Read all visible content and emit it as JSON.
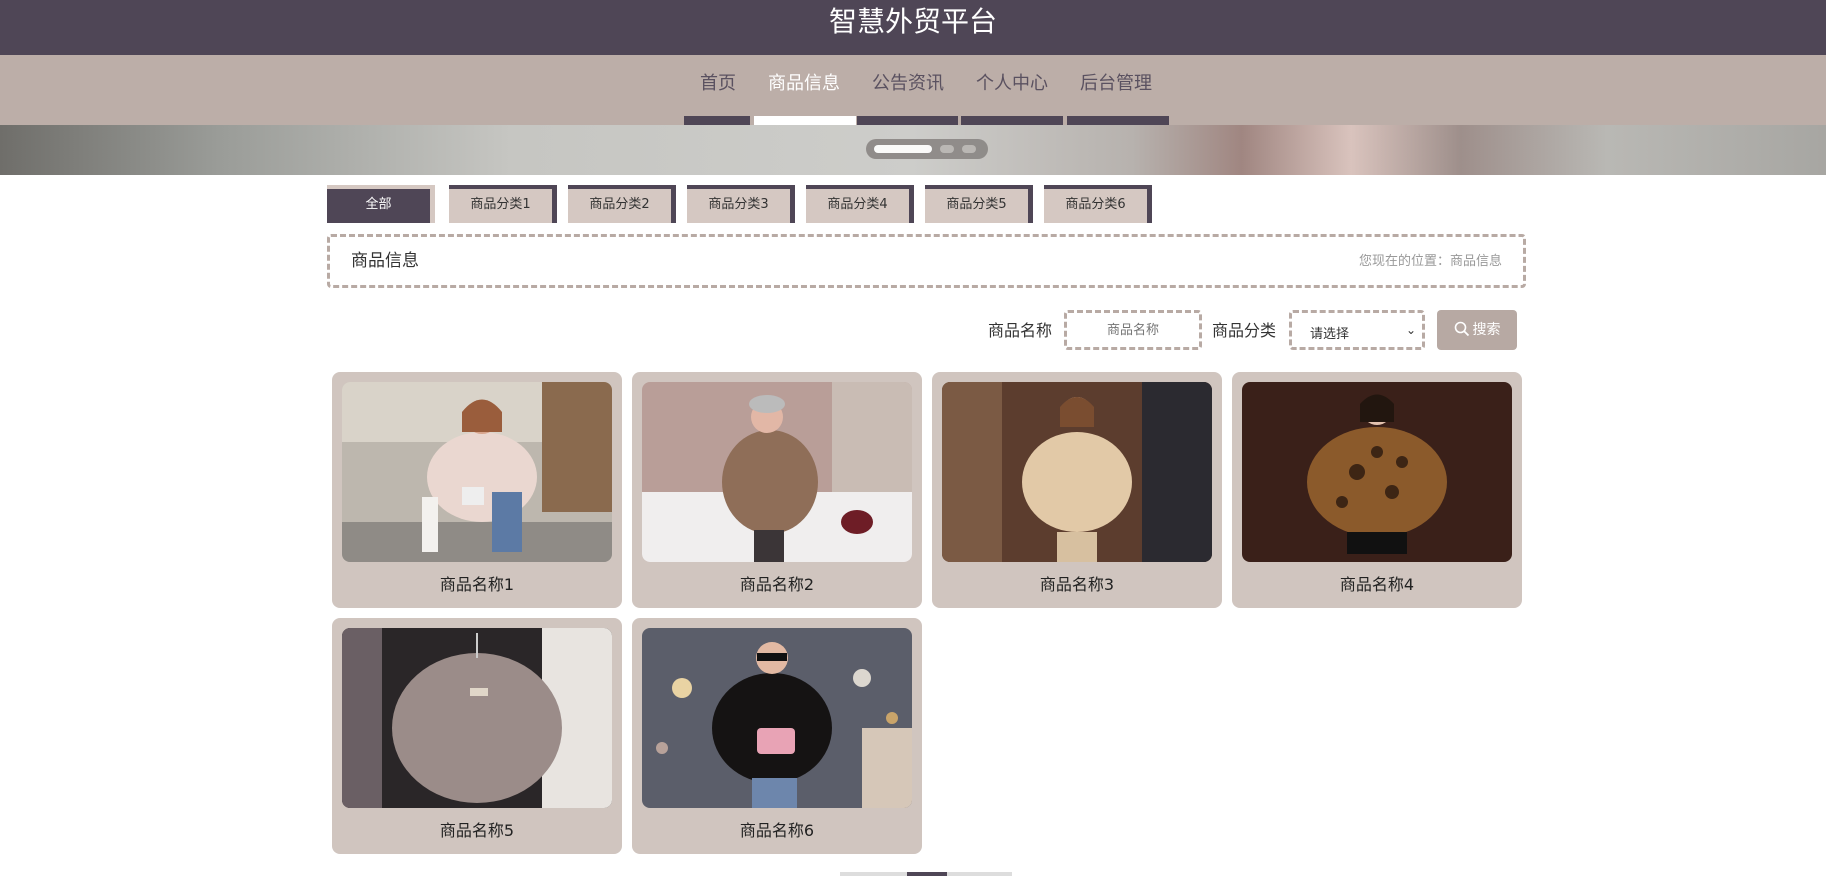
{
  "header": {
    "title": "智慧外贸平台"
  },
  "nav": {
    "items": [
      {
        "label": "首页",
        "active": false
      },
      {
        "label": "商品信息",
        "active": true
      },
      {
        "label": "公告资讯",
        "active": false
      },
      {
        "label": "个人中心",
        "active": false
      },
      {
        "label": "后台管理",
        "active": false
      }
    ]
  },
  "categories": [
    "全部",
    "商品分类1",
    "商品分类2",
    "商品分类3",
    "商品分类4",
    "商品分类5",
    "商品分类6"
  ],
  "info": {
    "title": "商品信息",
    "location": "您现在的位置：商品信息"
  },
  "search": {
    "name_label": "商品名称",
    "name_placeholder": "商品名称",
    "category_label": "商品分类",
    "category_value": "请选择",
    "button_label": "搜索"
  },
  "products": [
    {
      "name": "商品名称1"
    },
    {
      "name": "商品名称2"
    },
    {
      "name": "商品名称3"
    },
    {
      "name": "商品名称4"
    },
    {
      "name": "商品名称5"
    },
    {
      "name": "商品名称6"
    }
  ],
  "colors": {
    "header": "#4f4656",
    "nav": "#bcaea8",
    "card": "#d0c5bf",
    "accent": "#b7a9a3"
  }
}
